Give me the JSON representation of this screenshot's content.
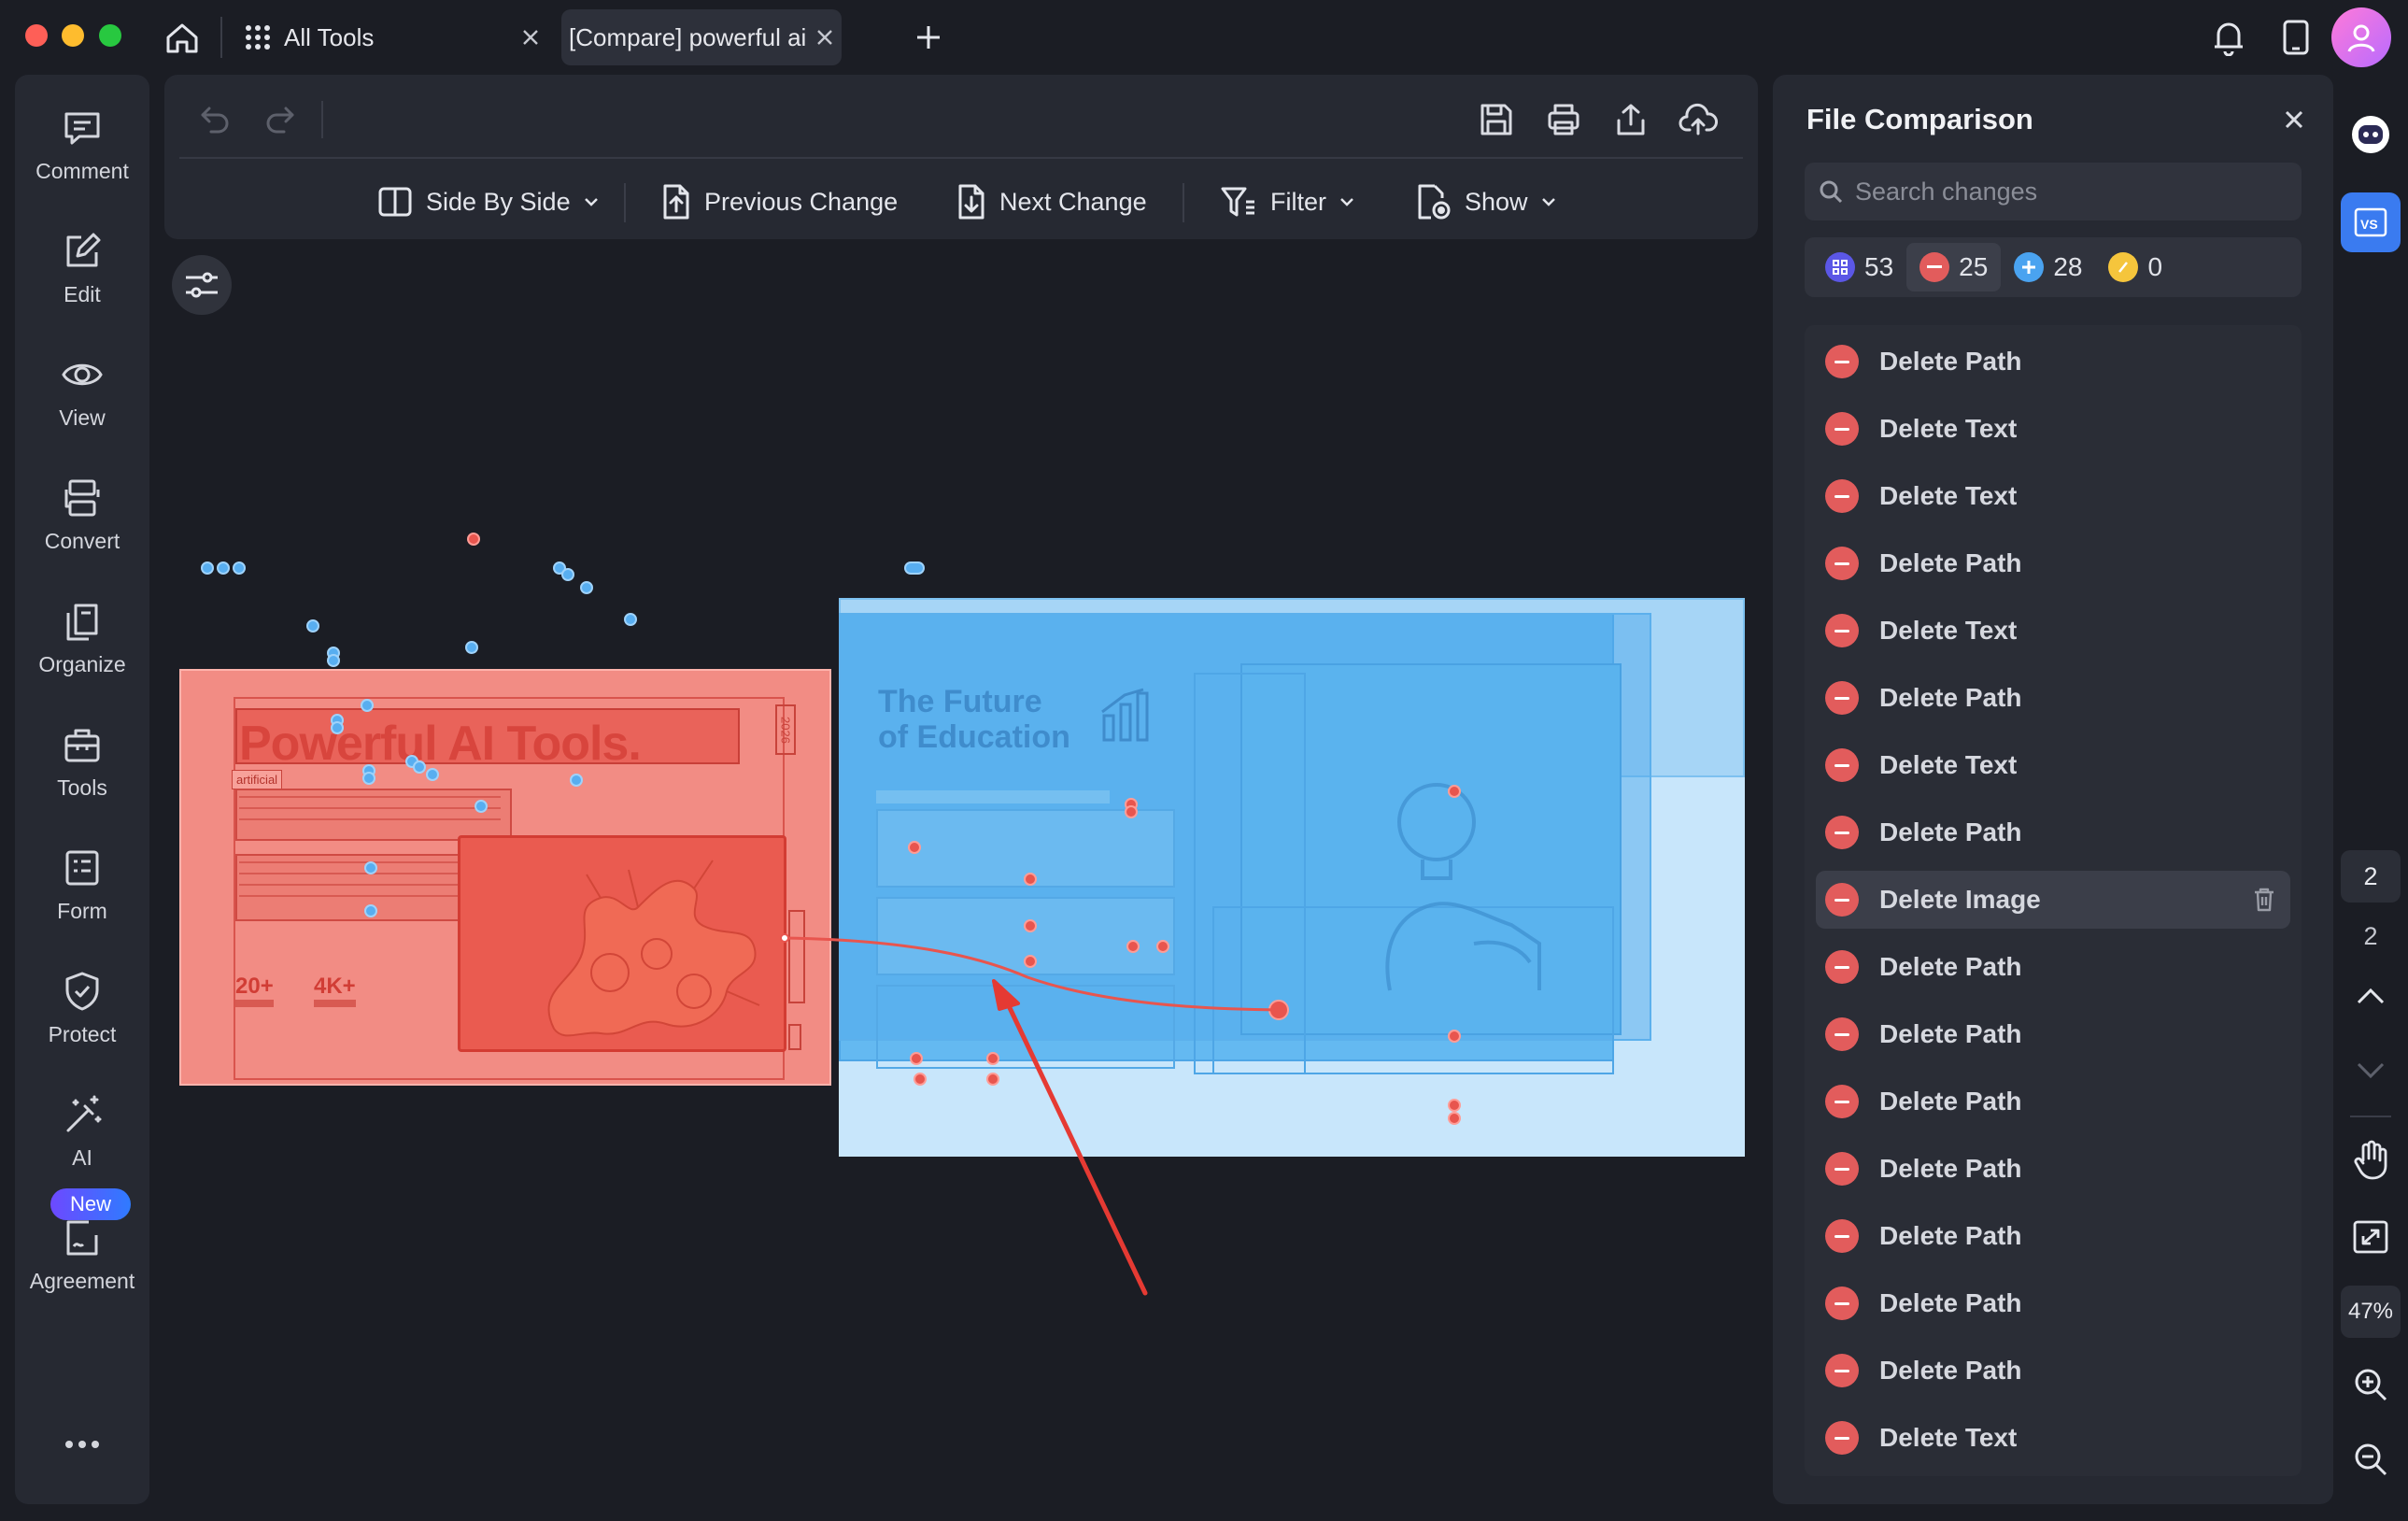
{
  "tabs": [
    {
      "label": "All Tools"
    },
    {
      "label": "[Compare] powerful ai..."
    }
  ],
  "sidebar": {
    "items": [
      {
        "label": "Comment",
        "icon": "comment-icon"
      },
      {
        "label": "Edit",
        "icon": "edit-icon"
      },
      {
        "label": "View",
        "icon": "eye-icon"
      },
      {
        "label": "Convert",
        "icon": "convert-icon"
      },
      {
        "label": "Organize",
        "icon": "organize-icon"
      },
      {
        "label": "Tools",
        "icon": "toolbox-icon"
      },
      {
        "label": "Form",
        "icon": "form-icon"
      },
      {
        "label": "Protect",
        "icon": "shield-icon"
      },
      {
        "label": "AI",
        "icon": "magic-wand-icon"
      },
      {
        "label": "Agreement",
        "icon": "agreement-icon"
      }
    ],
    "new_badge": "New"
  },
  "toolbar": {
    "side_by_side": "Side By Side",
    "previous_change": "Previous Change",
    "next_change": "Next Change",
    "filter": "Filter",
    "show": "Show"
  },
  "document": {
    "left_title": "Powerful AI Tools.",
    "left_tag": "artificial",
    "left_year": "2026",
    "left_stat1": "20+",
    "left_stat2": "4K+",
    "right_title_line1": "The Future",
    "right_title_line2": "of Education"
  },
  "panel": {
    "title": "File Comparison",
    "search_placeholder": "Search changes",
    "counts": {
      "all": "53",
      "deleted": "25",
      "added": "28",
      "modified": "0"
    },
    "changes": [
      "Delete Path",
      "Delete Text",
      "Delete Text",
      "Delete Path",
      "Delete Text",
      "Delete Path",
      "Delete Text",
      "Delete Path",
      "Delete Image",
      "Delete Path",
      "Delete Path",
      "Delete Path",
      "Delete Path",
      "Delete Path",
      "Delete Path",
      "Delete Path",
      "Delete Text"
    ],
    "selected_index": 8
  },
  "rail": {
    "page_current": "2",
    "page_total": "2",
    "zoom": "47%"
  },
  "colors": {
    "deleted": "#e25c5c",
    "added": "#4aa3f0",
    "modified": "#f5c53c",
    "all": "#6b5cff",
    "left_doc_overlay": "#f28c84",
    "right_doc_overlay": "#c8e6fb"
  }
}
